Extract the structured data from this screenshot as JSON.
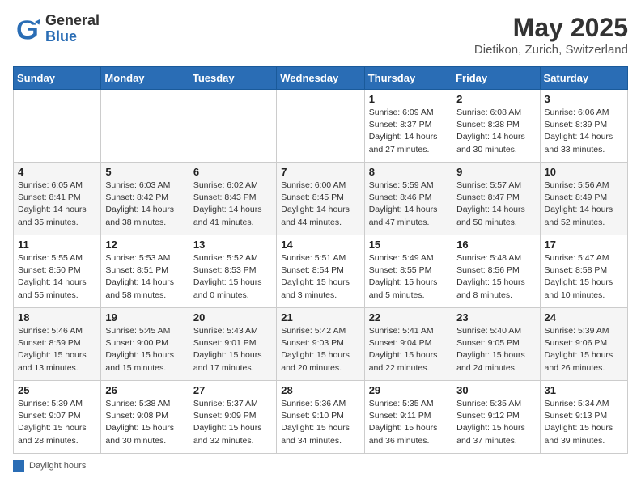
{
  "header": {
    "logo_general": "General",
    "logo_blue": "Blue",
    "month": "May 2025",
    "location": "Dietikon, Zurich, Switzerland"
  },
  "weekdays": [
    "Sunday",
    "Monday",
    "Tuesday",
    "Wednesday",
    "Thursday",
    "Friday",
    "Saturday"
  ],
  "legend": "Daylight hours",
  "weeks": [
    [
      {
        "day": "",
        "info": ""
      },
      {
        "day": "",
        "info": ""
      },
      {
        "day": "",
        "info": ""
      },
      {
        "day": "",
        "info": ""
      },
      {
        "day": "1",
        "info": "Sunrise: 6:09 AM\nSunset: 8:37 PM\nDaylight: 14 hours\nand 27 minutes."
      },
      {
        "day": "2",
        "info": "Sunrise: 6:08 AM\nSunset: 8:38 PM\nDaylight: 14 hours\nand 30 minutes."
      },
      {
        "day": "3",
        "info": "Sunrise: 6:06 AM\nSunset: 8:39 PM\nDaylight: 14 hours\nand 33 minutes."
      }
    ],
    [
      {
        "day": "4",
        "info": "Sunrise: 6:05 AM\nSunset: 8:41 PM\nDaylight: 14 hours\nand 35 minutes."
      },
      {
        "day": "5",
        "info": "Sunrise: 6:03 AM\nSunset: 8:42 PM\nDaylight: 14 hours\nand 38 minutes."
      },
      {
        "day": "6",
        "info": "Sunrise: 6:02 AM\nSunset: 8:43 PM\nDaylight: 14 hours\nand 41 minutes."
      },
      {
        "day": "7",
        "info": "Sunrise: 6:00 AM\nSunset: 8:45 PM\nDaylight: 14 hours\nand 44 minutes."
      },
      {
        "day": "8",
        "info": "Sunrise: 5:59 AM\nSunset: 8:46 PM\nDaylight: 14 hours\nand 47 minutes."
      },
      {
        "day": "9",
        "info": "Sunrise: 5:57 AM\nSunset: 8:47 PM\nDaylight: 14 hours\nand 50 minutes."
      },
      {
        "day": "10",
        "info": "Sunrise: 5:56 AM\nSunset: 8:49 PM\nDaylight: 14 hours\nand 52 minutes."
      }
    ],
    [
      {
        "day": "11",
        "info": "Sunrise: 5:55 AM\nSunset: 8:50 PM\nDaylight: 14 hours\nand 55 minutes."
      },
      {
        "day": "12",
        "info": "Sunrise: 5:53 AM\nSunset: 8:51 PM\nDaylight: 14 hours\nand 58 minutes."
      },
      {
        "day": "13",
        "info": "Sunrise: 5:52 AM\nSunset: 8:53 PM\nDaylight: 15 hours\nand 0 minutes."
      },
      {
        "day": "14",
        "info": "Sunrise: 5:51 AM\nSunset: 8:54 PM\nDaylight: 15 hours\nand 3 minutes."
      },
      {
        "day": "15",
        "info": "Sunrise: 5:49 AM\nSunset: 8:55 PM\nDaylight: 15 hours\nand 5 minutes."
      },
      {
        "day": "16",
        "info": "Sunrise: 5:48 AM\nSunset: 8:56 PM\nDaylight: 15 hours\nand 8 minutes."
      },
      {
        "day": "17",
        "info": "Sunrise: 5:47 AM\nSunset: 8:58 PM\nDaylight: 15 hours\nand 10 minutes."
      }
    ],
    [
      {
        "day": "18",
        "info": "Sunrise: 5:46 AM\nSunset: 8:59 PM\nDaylight: 15 hours\nand 13 minutes."
      },
      {
        "day": "19",
        "info": "Sunrise: 5:45 AM\nSunset: 9:00 PM\nDaylight: 15 hours\nand 15 minutes."
      },
      {
        "day": "20",
        "info": "Sunrise: 5:43 AM\nSunset: 9:01 PM\nDaylight: 15 hours\nand 17 minutes."
      },
      {
        "day": "21",
        "info": "Sunrise: 5:42 AM\nSunset: 9:03 PM\nDaylight: 15 hours\nand 20 minutes."
      },
      {
        "day": "22",
        "info": "Sunrise: 5:41 AM\nSunset: 9:04 PM\nDaylight: 15 hours\nand 22 minutes."
      },
      {
        "day": "23",
        "info": "Sunrise: 5:40 AM\nSunset: 9:05 PM\nDaylight: 15 hours\nand 24 minutes."
      },
      {
        "day": "24",
        "info": "Sunrise: 5:39 AM\nSunset: 9:06 PM\nDaylight: 15 hours\nand 26 minutes."
      }
    ],
    [
      {
        "day": "25",
        "info": "Sunrise: 5:39 AM\nSunset: 9:07 PM\nDaylight: 15 hours\nand 28 minutes."
      },
      {
        "day": "26",
        "info": "Sunrise: 5:38 AM\nSunset: 9:08 PM\nDaylight: 15 hours\nand 30 minutes."
      },
      {
        "day": "27",
        "info": "Sunrise: 5:37 AM\nSunset: 9:09 PM\nDaylight: 15 hours\nand 32 minutes."
      },
      {
        "day": "28",
        "info": "Sunrise: 5:36 AM\nSunset: 9:10 PM\nDaylight: 15 hours\nand 34 minutes."
      },
      {
        "day": "29",
        "info": "Sunrise: 5:35 AM\nSunset: 9:11 PM\nDaylight: 15 hours\nand 36 minutes."
      },
      {
        "day": "30",
        "info": "Sunrise: 5:35 AM\nSunset: 9:12 PM\nDaylight: 15 hours\nand 37 minutes."
      },
      {
        "day": "31",
        "info": "Sunrise: 5:34 AM\nSunset: 9:13 PM\nDaylight: 15 hours\nand 39 minutes."
      }
    ]
  ]
}
